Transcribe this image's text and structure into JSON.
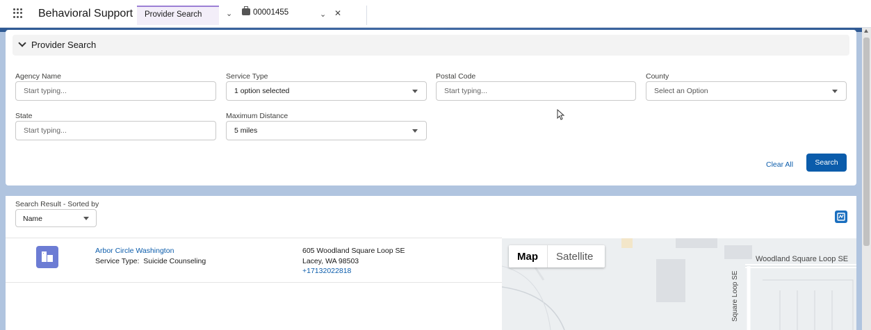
{
  "app": {
    "name": "Behavioral Support"
  },
  "tabs": [
    {
      "label": "Provider Search"
    },
    {
      "label": "00001455"
    }
  ],
  "provider_search": {
    "section_title": "Provider Search",
    "fields": {
      "agency_name": {
        "label": "Agency Name",
        "placeholder": "Start typing..."
      },
      "service_type": {
        "label": "Service Type",
        "value": "1 option selected"
      },
      "postal_code": {
        "label": "Postal Code",
        "placeholder": "Start typing..."
      },
      "county": {
        "label": "County",
        "value": "Select an Option"
      },
      "state": {
        "label": "State",
        "placeholder": "Start typing..."
      },
      "maximum_distance": {
        "label": "Maximum Distance",
        "value": "5 miles"
      }
    },
    "clear_all_label": "Clear All",
    "search_label": "Search"
  },
  "results": {
    "sorted_label": "Search Result - Sorted by",
    "sort_value": "Name",
    "items": [
      {
        "name": "Arbor Circle Washington",
        "service_type_label": "Service Type:",
        "service_type": "Suicide Counseling",
        "address_line1": "605 Woodland Square Loop SE",
        "address_line2": "Lacey, WA 98503",
        "phone": "+17132022818"
      }
    ]
  },
  "map": {
    "tab_map": "Map",
    "tab_satellite": "Satellite",
    "street_label_1": "Woodland Square Loop SE",
    "street_label_2": "Square Loop SE"
  },
  "colors": {
    "brand_blue": "#0b5cab",
    "tab_accent": "#9b7fd4",
    "agency_icon": "#6c7cd4"
  }
}
